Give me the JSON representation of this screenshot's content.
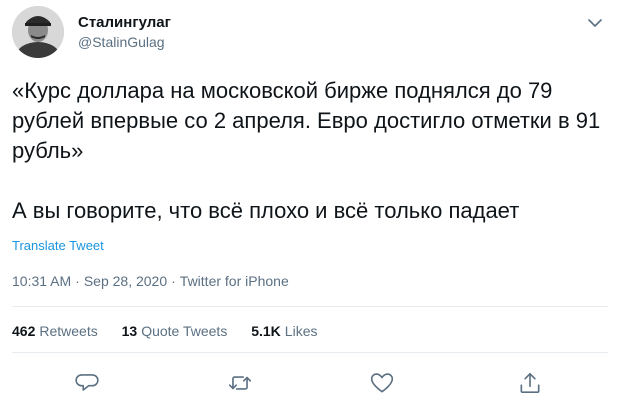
{
  "user": {
    "display_name": "Сталингулаг",
    "handle": "@StalinGulag"
  },
  "tweet": {
    "paragraphs": [
      "«Курс доллара на московской бирже поднялся до 79 рублей впервые со 2 апреля. Евро достигло отметки в 91 рубль»",
      "А вы говорите, что всё плохо и всё только падает"
    ],
    "translate_label": "Translate Tweet",
    "time": "10:31 AM",
    "date": "Sep 28, 2020",
    "source": "Twitter for iPhone"
  },
  "stats": {
    "retweets_count": "462",
    "retweets_label": "Retweets",
    "quote_count": "13",
    "quote_label": "Quote Tweets",
    "likes_count": "5.1K",
    "likes_label": "Likes"
  },
  "icons": {
    "caret": "chevron-down-icon",
    "reply": "reply-icon",
    "retweet": "retweet-icon",
    "like": "heart-icon",
    "share": "share-icon"
  },
  "colors": {
    "text": "#0f1419",
    "secondary": "#5b7083",
    "link": "#1b95e0",
    "divider": "#e6ecf0"
  }
}
